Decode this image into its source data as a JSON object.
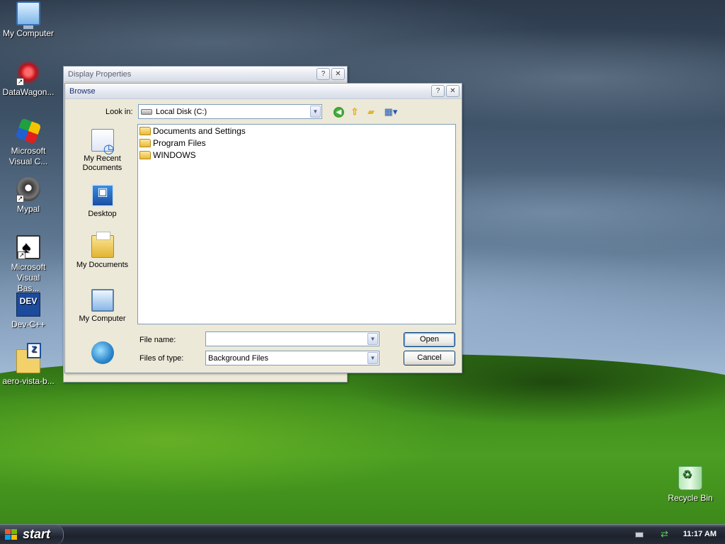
{
  "desktop": {
    "icons": [
      {
        "label": "My Computer",
        "icon": "my-computer-icon"
      },
      {
        "label": "DataWagon...",
        "icon": "datawagon-icon"
      },
      {
        "label": "Microsoft Visual C...",
        "icon": "visual-c-icon"
      },
      {
        "label": "Mypal",
        "icon": "mypal-icon"
      },
      {
        "label": "Microsoft Visual Bas...",
        "icon": "visual-basic-icon"
      },
      {
        "label": "Dev-C++",
        "icon": "dev-cpp-icon",
        "badge": "DEV"
      },
      {
        "label": "aero-vista-b...",
        "icon": "zip-folder-icon"
      },
      {
        "label": "Recycle Bin",
        "icon": "recycle-bin-icon"
      }
    ]
  },
  "display_properties": {
    "title": "Display Properties",
    "help": "?",
    "close": "✕"
  },
  "browse": {
    "title": "Browse",
    "help": "?",
    "close": "✕",
    "look_in_label": "Look in:",
    "look_in_value": "Local Disk (C:)",
    "places": [
      {
        "label": "My Recent Documents"
      },
      {
        "label": "Desktop"
      },
      {
        "label": "My Documents"
      },
      {
        "label": "My Computer"
      },
      {
        "label": ""
      }
    ],
    "files": [
      {
        "name": "Documents and Settings"
      },
      {
        "name": "Program Files"
      },
      {
        "name": "WINDOWS"
      }
    ],
    "file_name_label": "File name:",
    "file_name_value": "",
    "file_type_label": "Files of type:",
    "file_type_value": "Background Files",
    "open_label": "Open",
    "cancel_label": "Cancel"
  },
  "taskbar": {
    "start_label": "start",
    "clock": "11:17 AM"
  },
  "colors": {
    "xp_blue": "#1c4a9c",
    "dialog_bg": "#ece9d8",
    "list_border": "#7f9db9"
  }
}
